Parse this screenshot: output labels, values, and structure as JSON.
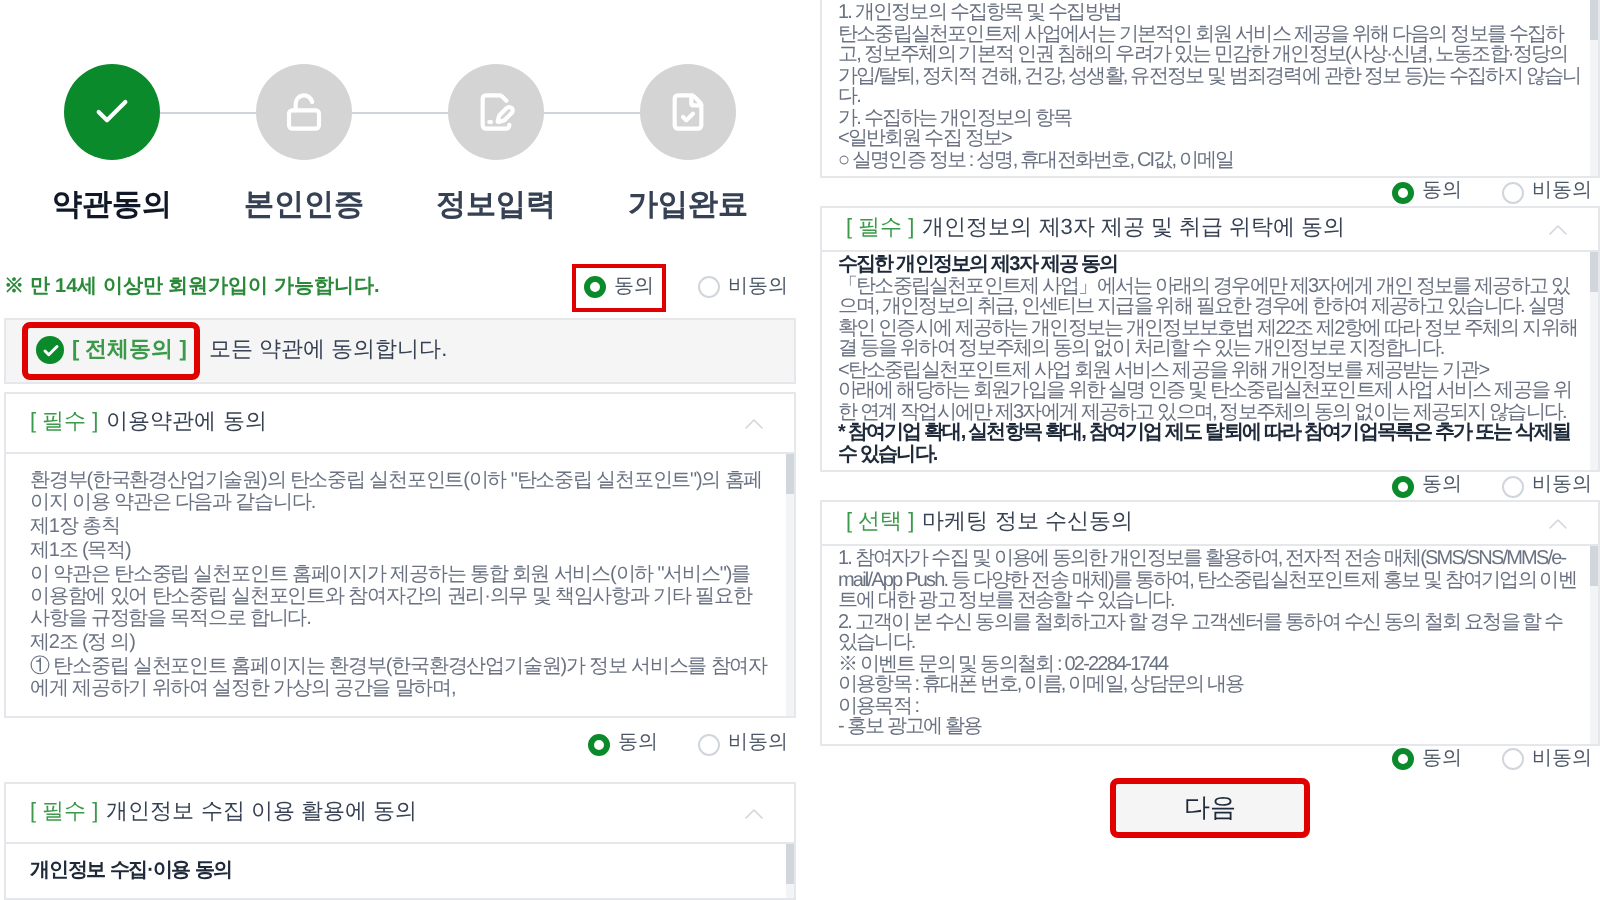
{
  "steps": [
    {
      "label": "약관동의",
      "selected": true
    },
    {
      "label": "본인인증",
      "selected": false
    },
    {
      "label": "정보입력",
      "selected": false
    },
    {
      "label": "가입완료",
      "selected": false
    }
  ],
  "age_notice": "※ 만 14세 이상만 회원가입이 가능합니다.",
  "all_agree_options": {
    "highlighted": true,
    "options": [
      {
        "label": "동의",
        "selected": true
      },
      {
        "label": "비동의",
        "selected": false
      }
    ]
  },
  "all_agree_bar": {
    "tag": "[ 전체동의 ]",
    "text": "모든 약관에 동의합니다.",
    "checked": true,
    "highlighted": true
  },
  "left_panels": [
    {
      "tag": "[ 필수 ]",
      "title": "이용약관에 동의",
      "expanded": true,
      "lines": [
        {
          "text": "환경부(한국환경산업기술원)의 탄소중립 실천포인트(이하 \"탄소중립 실천포인트\")의 홈페이지 이용 약관은 다음과 같습니다.",
          "bold": false
        },
        {
          "text": "제1장 총칙",
          "bold": false
        },
        {
          "text": "제1조 (목적)",
          "bold": false
        },
        {
          "text": "이 약관은 탄소중립 실천포인트 홈페이지가 제공하는 통합 회원 서비스(이하 \"서비스\")를 이용함에 있어 탄소중립 실천포인트와 참여자간의 권리·의무 및 책임사항과 기타 필요한 사항을 규정함을 목적으로 합니다.",
          "bold": false
        },
        {
          "text": "제2조 (정 의)",
          "bold": false
        },
        {
          "text": "① 탄소중립 실천포인트 홈페이지는 환경부(한국환경산업기술원)가 정보 서비스를 참여자에게 제공하기 위하여 설정한 가상의 공간을 말하며,",
          "bold": false
        }
      ],
      "options": [
        {
          "label": "동의",
          "selected": true
        },
        {
          "label": "비동의",
          "selected": false
        }
      ]
    },
    {
      "tag": "[ 필수 ]",
      "title": "개인정보 수집 이용 활용에 동의",
      "expanded": true,
      "lines": [
        {
          "text": "개인정보 수집·이용 동의",
          "bold": true
        }
      ]
    }
  ],
  "right_panels": [
    {
      "lines": [
        {
          "text": "1. 개인정보의 수집항목 및 수집방법",
          "bold": false
        },
        {
          "text": "탄소중립실천포인트제 사업에서는 기본적인 회원 서비스 제공을 위해 다음의 정보를 수집하고, 정보주체의 기본적 인권 침해의 우려가 있는 민감한 개인정보(사상·신념, 노동조합·정당의 가입/탈퇴, 정치적 견해, 건강, 성생활, 유전정보 및 범죄경력에 관한 정보 등)는 수집하지 않습니다.",
          "bold": false
        },
        {
          "text": "가. 수집하는 개인정보의 항목",
          "bold": false
        },
        {
          "text": "<일반회원 수집 정보>",
          "bold": false
        },
        {
          "text": "○ 실명인증 정보 : 성명, 휴대전화번호, CI값, 이메일",
          "bold": false
        }
      ],
      "options": [
        {
          "label": "동의",
          "selected": true
        },
        {
          "label": "비동의",
          "selected": false
        }
      ]
    },
    {
      "tag": "[ 필수 ]",
      "title": "개인정보의 제3자 제공 및 취급 위탁에 동의",
      "expanded": true,
      "lines": [
        {
          "text": "수집한 개인정보의 제3자 제공 동의",
          "bold": true
        },
        {
          "text": "「탄소중립실천포인트제 사업」에서는 아래의 경우에만 제3자에게 개인 정보를 제공하고 있으며, 개인정보의 취급, 인센티브 지급을 위해 필요한 경우에 한하여 제공하고 있습니다. 실명확인 인증시에 제공하는 개인정보는 개인정보보호법 제22조 제2항에 따라 정보 주체의 지위해결 등을 위하여 정보주체의 동의 없이 처리할 수 있는 개인정보로 지정합니다.",
          "bold": false
        },
        {
          "text": "<탄소중립실천포인트제 사업 회원 서비스 제공을 위해 개인정보를 제공받는 기관>",
          "bold": false
        },
        {
          "text": "아래에 해당하는 회원가입을 위한 실명 인증 및 탄소중립실천포인트제 사업 서비스 제공을 위한 연계 작업시에만 제3자에게 제공하고 있으며, 정보주체의 동의 없이는 제공되지 않습니다.",
          "bold": false
        },
        {
          "text": "* 참여기업 확대, 실천항목 확대, 참여기업 제도 탈퇴에 따라 참여기업목록은 추가 또는 삭제될 수 있습니다.",
          "bold": true
        }
      ],
      "options": [
        {
          "label": "동의",
          "selected": true
        },
        {
          "label": "비동의",
          "selected": false
        }
      ]
    },
    {
      "tag": "[ 선택 ]",
      "title": "마케팅 정보 수신동의",
      "expanded": true,
      "lines": [
        {
          "text": "1. 참여자가 수집 및 이용에 동의한 개인정보를 활용하여, 전자적 전송 매체(SMS/SNS/MMS/e-mail/App Push. 등 다양한 전송 매체)를 통하여, 탄소중립실천포인트제 홍보 및 참여기업의 이벤트에 대한 광고 정보를 전송할 수 있습니다.",
          "bold": false
        },
        {
          "text": "2. 고객이 본 수신 동의를 철회하고자 할 경우 고객센터를 통하여 수신 동의 철회 요청을 할 수 있습니다.",
          "bold": false
        },
        {
          "text": "※ 이벤트 문의 및 동의철회 : 02-2284-1744",
          "bold": false
        },
        {
          "text": "이용항목 : 휴대폰 번호, 이름, 이메일, 상담문의 내용",
          "bold": false
        },
        {
          "text": "이용목적 :",
          "bold": false
        },
        {
          "text": "- 홍보 광고에 활용",
          "bold": false
        }
      ],
      "options": [
        {
          "label": "동의",
          "selected": true
        },
        {
          "label": "비동의",
          "selected": false
        }
      ]
    }
  ],
  "next_button": {
    "label": "다음",
    "highlighted": true
  }
}
